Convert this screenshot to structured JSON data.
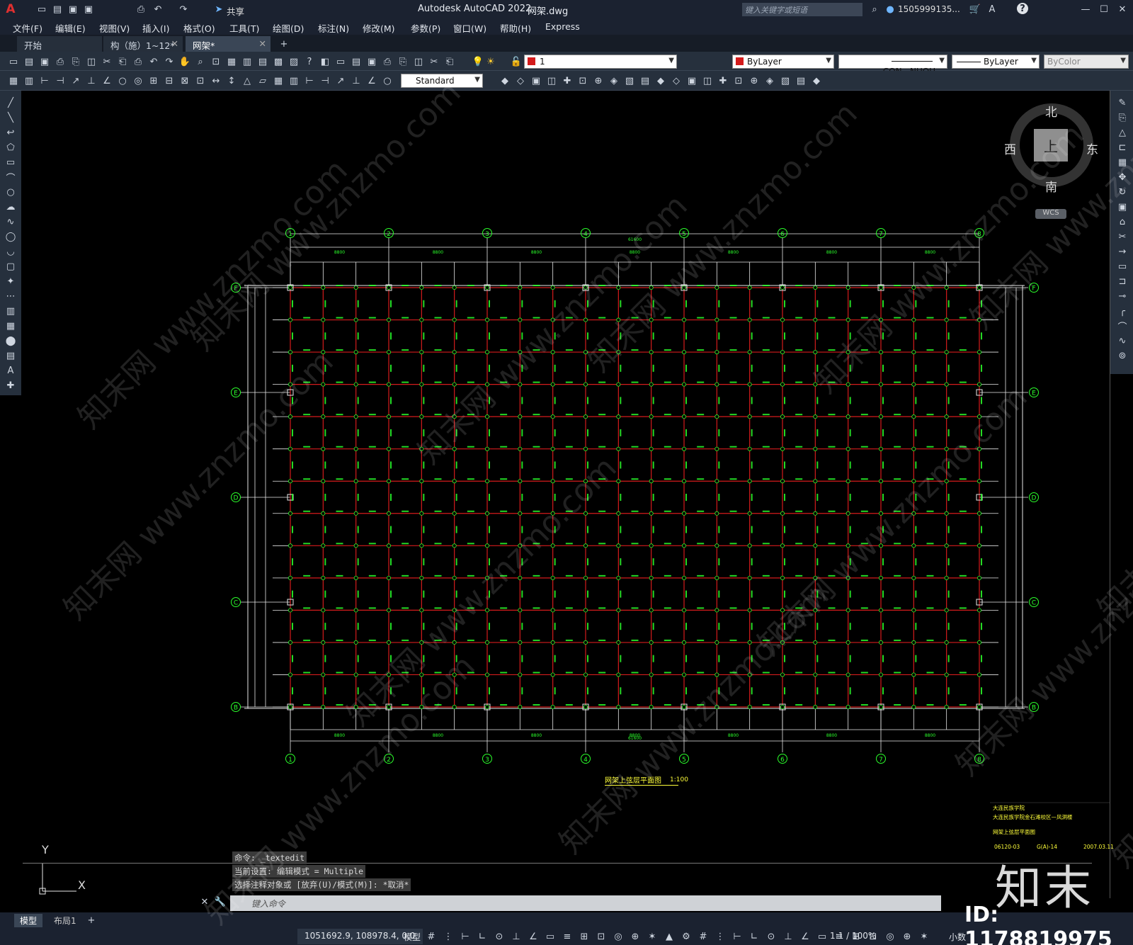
{
  "title_bar": {
    "app_name": "Autodesk AutoCAD 2022",
    "file_name": "网架.dwg",
    "share_label": "共享",
    "search_placeholder": "键入关键字或短语",
    "user": "1505999135...",
    "help_icon": "?"
  },
  "menu": [
    "文件(F)",
    "编辑(E)",
    "视图(V)",
    "插入(I)",
    "格式(O)",
    "工具(T)",
    "绘图(D)",
    "标注(N)",
    "修改(M)",
    "参数(P)",
    "窗口(W)",
    "帮助(H)",
    "Express"
  ],
  "tabs": [
    {
      "label": "开始",
      "active": false
    },
    {
      "label": "构（施）1~12*",
      "active": false
    },
    {
      "label": "网架*",
      "active": true
    }
  ],
  "toolbar": {
    "layer_value": "1",
    "color_value": "ByLayer",
    "linetype_value": "CON...NUOU",
    "lineweight_value": "ByLayer",
    "plotstyle_value": "ByColor",
    "textstyle_value": "Standard"
  },
  "viewcube": {
    "north": "北",
    "south": "南",
    "east": "东",
    "west": "西",
    "top": "上",
    "wcs": "WCS"
  },
  "drawing": {
    "axis_top": [
      "1",
      "2",
      "3",
      "4",
      "5",
      "6",
      "7",
      "8"
    ],
    "axis_side": [
      "F",
      "E",
      "D",
      "C",
      "B"
    ],
    "total_width_dim": "61600",
    "bay_dim": "8800",
    "plan_title": "网架上弦层平面图",
    "scale": "1:100",
    "titleblock": [
      "大连民族学院",
      "大连民族学院金石滩校区—风洞楼",
      "网架上弦层平面图",
      "06120-03",
      "G(A)-14",
      "2007.03.11"
    ]
  },
  "ucs": {
    "y": "Y",
    "x": "X"
  },
  "command": {
    "history": [
      "命令: _textedit",
      "当前设置: 编辑模式 = Multiple",
      "选择注释对象或 [放弃(U)/模式(M)]: *取消*"
    ],
    "input_placeholder": "键入命令"
  },
  "layouts": [
    "模型",
    "布局1"
  ],
  "status": {
    "coords": "1051692.9, 108978.4, 0.0",
    "model": "模型",
    "scale": "1:1 / 100%",
    "units": "小数"
  },
  "watermark": {
    "brand": "知末",
    "id": "ID: 1178819975",
    "site": "知末网 www.znzmo.com"
  },
  "colors": {
    "grid_red": "#d41c1c",
    "axis_white": "#e8e8e8",
    "label_green": "#2bff2b",
    "title_yellow": "#ffff3a"
  }
}
